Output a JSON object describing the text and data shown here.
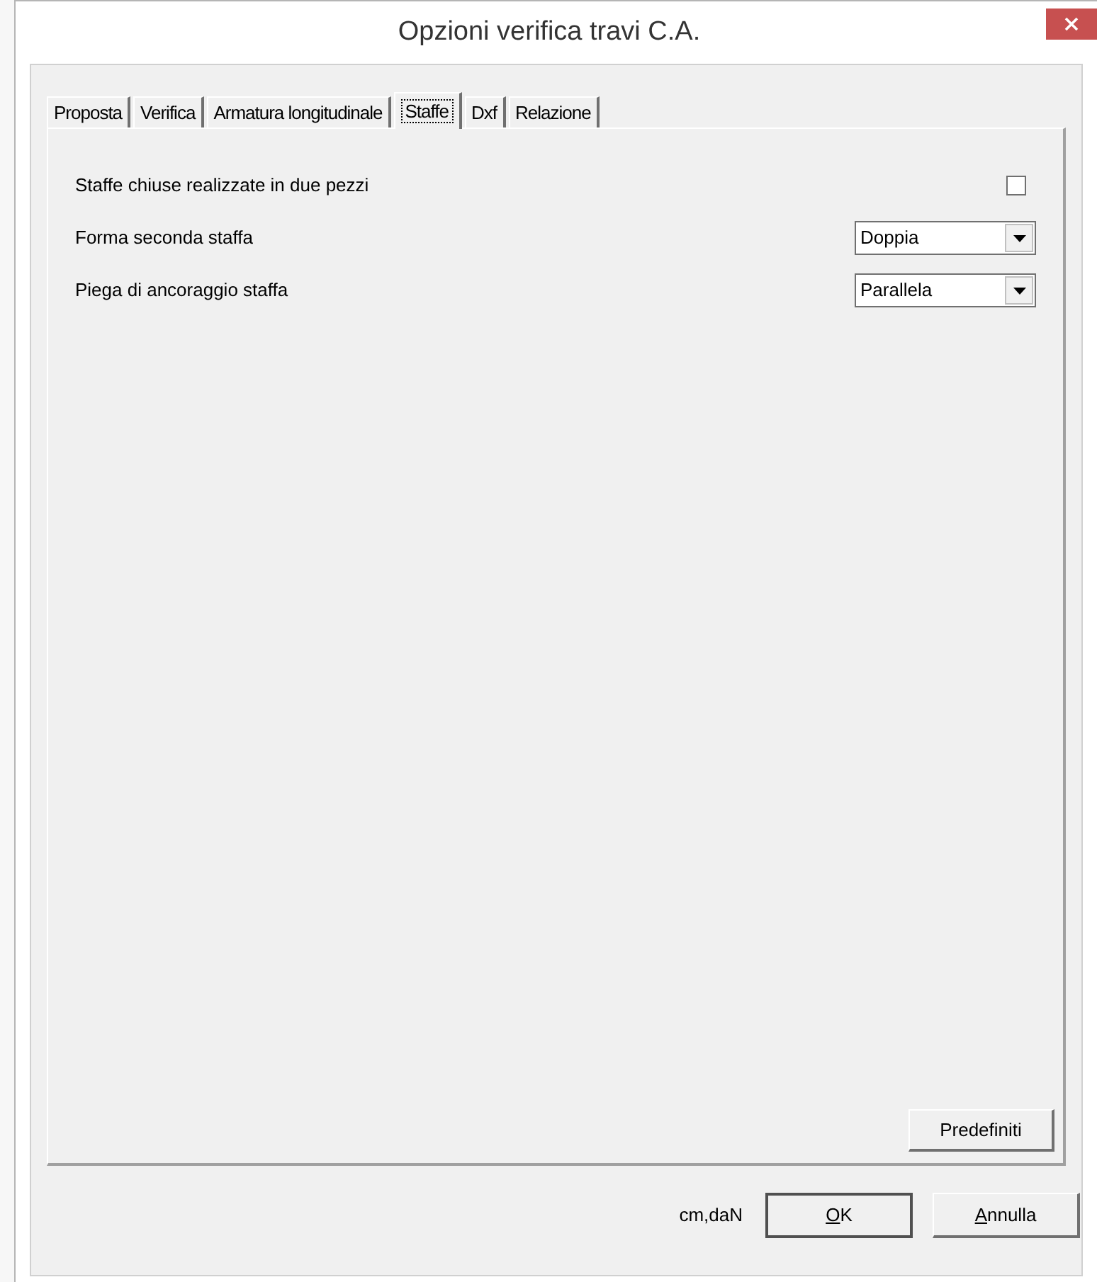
{
  "window": {
    "title": "Opzioni verifica travi C.A."
  },
  "tabs": [
    {
      "label": "Proposta",
      "selected": false
    },
    {
      "label": "Verifica",
      "selected": false
    },
    {
      "label": "Armatura longitudinale",
      "selected": false
    },
    {
      "label": "Staffe",
      "selected": true
    },
    {
      "label": "Dxf",
      "selected": false
    },
    {
      "label": "Relazione",
      "selected": false
    }
  ],
  "options": [
    {
      "kind": "checkbox",
      "label": "Staffe chiuse realizzate in due pezzi",
      "checked": false
    },
    {
      "kind": "dropdown",
      "label": "Forma seconda staffa",
      "value": "Doppia"
    },
    {
      "kind": "dropdown",
      "label": "Piega di ancoraggio staffa",
      "value": "Parallela"
    }
  ],
  "defaults_button": "Predefiniti",
  "units": "cm,daN",
  "buttons": [
    {
      "mnemonic": "O",
      "rest": "K",
      "default": true
    },
    {
      "mnemonic": "A",
      "rest": "nnulla",
      "default": false
    }
  ]
}
